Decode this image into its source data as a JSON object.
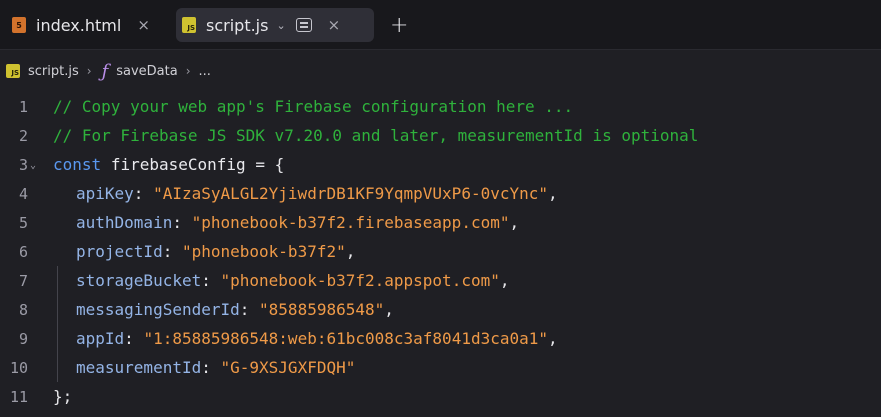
{
  "tabs": [
    {
      "label": "index.html",
      "icon": "html-file-icon",
      "icon_glyph": "5"
    },
    {
      "label": "script.js",
      "icon": "js-file-icon",
      "icon_glyph": "JS",
      "active": true
    }
  ],
  "tab_close_glyph": "×",
  "tab_chevron_glyph": "⌄",
  "new_tab_glyph": "+",
  "breadcrumb": {
    "file": "script.js",
    "symbol": "saveData",
    "more": "...",
    "separator": "›",
    "fn_glyph": "ƒ"
  },
  "editor": {
    "fold_glyph": "⌄",
    "lines": [
      {
        "n": "1",
        "comment": "// Copy your web app's Firebase configuration here ..."
      },
      {
        "n": "2",
        "comment": "// For Firebase JS SDK v7.20.0 and later, measurementId is optional"
      },
      {
        "n": "3",
        "keyword": "const",
        "ident": "firebaseConfig",
        "op": "= {"
      },
      {
        "n": "4",
        "prop": "apiKey",
        "value": "\"AIzaSyALGL2YjiwdrDB1KF9YqmpVUxP6-0vcYnc\"",
        "end": ","
      },
      {
        "n": "5",
        "prop": "authDomain",
        "value": "\"phonebook-b37f2.firebaseapp.com\"",
        "end": ","
      },
      {
        "n": "6",
        "prop": "projectId",
        "value": "\"phonebook-b37f2\"",
        "end": ","
      },
      {
        "n": "7",
        "prop": "storageBucket",
        "value": "\"phonebook-b37f2.appspot.com\"",
        "end": ","
      },
      {
        "n": "8",
        "prop": "messagingSenderId",
        "value": "\"85885986548\"",
        "end": ","
      },
      {
        "n": "9",
        "prop": "appId",
        "value": "\"1:85885986548:web:61bc008c3af8041d3ca0a1\"",
        "end": ","
      },
      {
        "n": "10",
        "prop": "measurementId",
        "value": "\"G-9XSJGXFDQH\"",
        "end": ""
      },
      {
        "n": "11",
        "closing": "};"
      }
    ]
  },
  "colors": {
    "comment": "#2fb23c",
    "keyword": "#5a98f0",
    "property": "#94b4e6",
    "string": "#ef9a48",
    "background": "#1f1f24"
  }
}
